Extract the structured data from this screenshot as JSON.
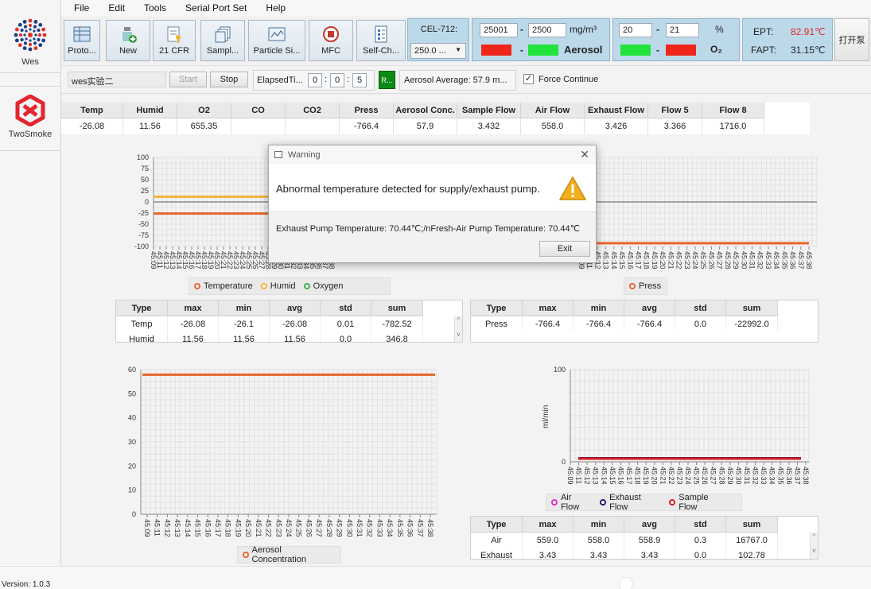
{
  "sidebar": {
    "apps": [
      {
        "label": "Wes",
        "icon": "wes-logo-icon"
      },
      {
        "label": "TwoSmoke",
        "icon": "twosmoke-logo-icon"
      }
    ]
  },
  "menu": [
    "File",
    "Edit",
    "Tools",
    "Serial Port Set",
    "Help"
  ],
  "toolbar": {
    "buttons": [
      {
        "label": "Proto...",
        "icon": "table-icon"
      },
      {
        "label": "New",
        "icon": "new-bottle-icon"
      },
      {
        "label": "21 CFR",
        "icon": "document-key-icon"
      },
      {
        "label": "Sampl...",
        "icon": "stacked-pages-icon"
      },
      {
        "label": "Particle Si...",
        "icon": "chart-window-icon"
      },
      {
        "label": "MFC",
        "icon": "record-icon"
      },
      {
        "label": "Self-Ch...",
        "icon": "checklist-icon"
      }
    ],
    "cel": {
      "label": "CEL-712:",
      "select_value": "250.0 ..."
    },
    "aerosol": {
      "min": "25001",
      "max": "2500",
      "unit": "mg/m³",
      "label": "Aerosol",
      "dash": "-"
    },
    "oxygen": {
      "min": "20",
      "max": "21",
      "unit": "%",
      "label": "O₂",
      "dash": "-"
    },
    "ept": {
      "label": "EPT:",
      "value": "82.91℃",
      "fapt_label": "FAPT:",
      "fapt_value": "31.15℃"
    },
    "open_pump": "打开泵",
    "colors": {
      "red": "#f0261a",
      "green": "#22e33b",
      "panel": "#bcd9ea"
    }
  },
  "row2": {
    "name_value": "wes实验二",
    "start": "Start",
    "stop": "Stop",
    "elapsed_label": "ElapsedTi...",
    "elapsed": [
      "0",
      "0",
      "5"
    ],
    "r_button": "R...",
    "aerosol_avg": "Aerosol Average:  57.9 m...",
    "force_continue": "Force Continue"
  },
  "datatable": {
    "headers": [
      "Temp",
      "Humid",
      "O2",
      "CO",
      "CO2",
      "Press",
      "Aerosol Conc.",
      "Sample Flow",
      "Air Flow",
      "Exhaust Flow",
      "Flow 5",
      "Flow 8"
    ],
    "values": [
      "-26.08",
      "11.56",
      "655.35",
      "",
      "",
      "-766.4",
      "57.9",
      "3.432",
      "558.0",
      "3.426",
      "3.366",
      "1716.0"
    ]
  },
  "charts": {
    "c1": {
      "legend": [
        "Temperature",
        "Humid",
        "Oxygen"
      ],
      "yticks": [
        "100",
        "75",
        "50",
        "25",
        "0",
        "-25",
        "-50",
        "-75",
        "-100"
      ]
    },
    "c2": {
      "legend": [
        "Press"
      ]
    },
    "c3": {
      "legend": [
        "Aerosol Concentration"
      ],
      "yticks": [
        "60",
        "50",
        "40",
        "30",
        "20",
        "10",
        "0"
      ]
    },
    "c4": {
      "legend": [
        "Air Flow",
        "Exhaust Flow",
        "Sample Flow"
      ],
      "yticks": [
        "100",
        "0"
      ],
      "ylabel": "ml/min"
    }
  },
  "chart_data": [
    {
      "type": "line",
      "ylim": [
        -100,
        100
      ],
      "x": [
        "45:09",
        "45:10",
        "45:11",
        "45:12",
        "45:13",
        "45:14",
        "45:15",
        "45:16",
        "45:17",
        "45:18",
        "45:19",
        "45:20",
        "45:21",
        "45:22",
        "45:23",
        "45:24",
        "45:25",
        "45:26",
        "45:27",
        "45:28",
        "45:29",
        "45:30",
        "45:31",
        "45:32",
        "45:33",
        "45:34",
        "45:35",
        "45:36",
        "45:37",
        "45:38"
      ],
      "xtick_labels": [
        "45:09",
        "45:11",
        "45:12",
        "45:13",
        "45:14",
        "45:15",
        "45:16",
        "45:17",
        "45:18",
        "45:19",
        "45:20",
        "45:21",
        "45:22",
        "45:23",
        "45:24",
        "45:25",
        "45:26",
        "45:27",
        "45:28",
        "45:29",
        "45:30",
        "45:31",
        "45:32",
        "45:33",
        "45:34",
        "45:35",
        "45:36",
        "45:37",
        "45:38"
      ],
      "series": [
        {
          "name": "Temperature",
          "value": -26.1,
          "color": "#e8642c"
        },
        {
          "name": "Humid",
          "value": 11.56,
          "color": "#f1b43d"
        },
        {
          "name": "Oxygen",
          "value": null,
          "color": "#3bb14a"
        }
      ],
      "grid": true,
      "legend": "bottom"
    },
    {
      "type": "line",
      "series": [
        {
          "name": "Press",
          "value": -766.4,
          "color": "#e8642c"
        }
      ],
      "xtick_labels": [
        "45:09",
        "45:11",
        "45:12",
        "45:13",
        "45:14",
        "45:15",
        "45:16",
        "45:17",
        "45:18",
        "45:19",
        "45:20",
        "45:21",
        "45:22",
        "45:23",
        "45:24",
        "45:25",
        "45:26",
        "45:27",
        "45:28",
        "45:29",
        "45:30",
        "45:31",
        "45:32",
        "45:33",
        "45:34",
        "45:35",
        "45:36",
        "45:37",
        "45:38"
      ],
      "grid": true,
      "legend": "bottom"
    },
    {
      "type": "line",
      "ylim": [
        0,
        60
      ],
      "x": [
        "45:09",
        "45:11",
        "45:12",
        "45:13",
        "45:14",
        "45:15",
        "45:16",
        "45:17",
        "45:18",
        "45:19",
        "45:20",
        "45:21",
        "45:22",
        "45:23",
        "45:24",
        "45:25",
        "45:26",
        "45:27",
        "45:28",
        "45:29",
        "45:30",
        "45:31",
        "45:32",
        "45:33",
        "45:34",
        "45:35",
        "45:36",
        "45:37",
        "45:38"
      ],
      "series": [
        {
          "name": "Aerosol Concentration",
          "value": 57.9,
          "color": "#e8642c"
        }
      ],
      "grid": true,
      "legend": "bottom"
    },
    {
      "type": "line",
      "ylim": [
        0,
        100
      ],
      "ylabel": "ml/min",
      "x": [
        "45:09",
        "45:11",
        "45:12",
        "45:13",
        "45:14",
        "45:15",
        "45:16",
        "45:17",
        "45:18",
        "45:19",
        "45:20",
        "45:21",
        "45:22",
        "45:23",
        "45:24",
        "45:25",
        "45:26",
        "45:27",
        "45:28",
        "45:29",
        "45:30",
        "45:31",
        "45:32",
        "45:33",
        "45:34",
        "45:35",
        "45:36",
        "45:37",
        "45:38"
      ],
      "series": [
        {
          "name": "Air Flow",
          "value": 558.0,
          "color": "#d633c9"
        },
        {
          "name": "Exhaust Flow",
          "value": 3.43,
          "color": "#1c1f6b"
        },
        {
          "name": "Sample Flow",
          "value": 3.43,
          "color": "#d81c1c"
        }
      ],
      "grid": true,
      "legend": "bottom"
    }
  ],
  "stats1": {
    "headers": [
      "Type",
      "max",
      "min",
      "avg",
      "std",
      "sum"
    ],
    "rows": [
      [
        "Temp",
        "-26.08",
        "-26.1",
        "-26.08",
        "0.01",
        "-782.52"
      ],
      [
        "Humid",
        "11.56",
        "11.56",
        "11.56",
        "0.0",
        "346.8"
      ]
    ]
  },
  "stats2": {
    "headers": [
      "Type",
      "max",
      "min",
      "avg",
      "std",
      "sum"
    ],
    "rows": [
      [
        "Press",
        "-766.4",
        "-766.4",
        "-766.4",
        "0.0",
        "-22992.0"
      ]
    ]
  },
  "stats4": {
    "headers": [
      "Type",
      "max",
      "min",
      "avg",
      "std",
      "sum"
    ],
    "rows": [
      [
        "Air",
        "559.0",
        "558.0",
        "558.9",
        "0.3",
        "16767.0"
      ],
      [
        "Exhaust",
        "3.43",
        "3.43",
        "3.43",
        "0.0",
        "102.78"
      ]
    ]
  },
  "dialog": {
    "title": "Warning",
    "message": "Abnormal temperature detected for supply/exhaust pump.",
    "detail": "Exhaust Pump Temperature: 70.44℃;/nFresh-Air Pump Temperature: 70.44℃",
    "exit": "Exit"
  },
  "status": {
    "version": "Version: 1.0.3"
  }
}
